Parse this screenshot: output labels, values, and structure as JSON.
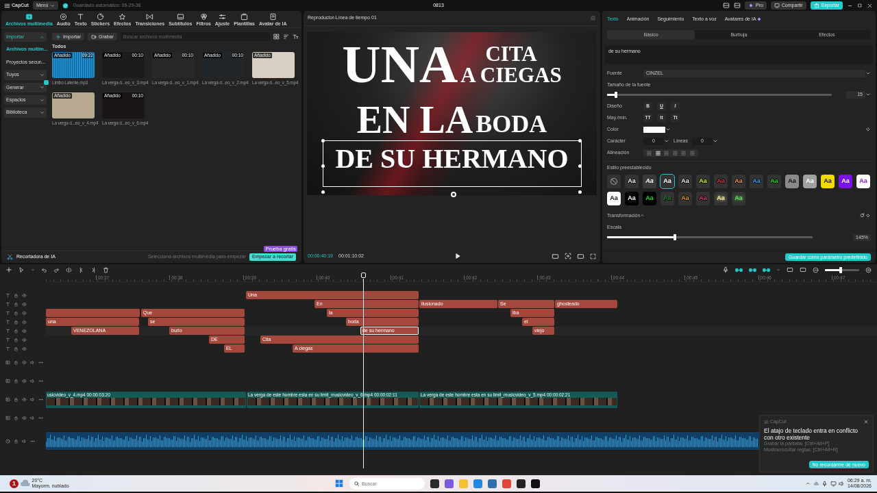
{
  "titlebar": {
    "app": "CapCut",
    "menu": "Menú",
    "autosave": "Guardado automático: 06-29-36",
    "project": "0813",
    "pro": "Pro",
    "share": "Compartir",
    "export": "Exportar"
  },
  "media_panel": {
    "tabs": [
      {
        "label": "Archivos multimedia",
        "selected": true
      },
      {
        "label": "Audio",
        "selected": false
      },
      {
        "label": "Texto",
        "selected": false
      },
      {
        "label": "Stickers",
        "selected": false
      },
      {
        "label": "Efectos",
        "selected": false
      },
      {
        "label": "Transiciones",
        "selected": false
      },
      {
        "label": "Subtítulos",
        "selected": false
      },
      {
        "label": "Filtros",
        "selected": false
      },
      {
        "label": "Ajuste",
        "selected": false
      },
      {
        "label": "Plantillas",
        "selected": false
      },
      {
        "label": "Avatar de IA",
        "selected": false
      }
    ],
    "sidebar": [
      {
        "label": "Importar",
        "kind": "group",
        "expanded": true,
        "selected": false,
        "has_badge": false
      },
      {
        "label": "Archivos multim...",
        "kind": "item",
        "selected": true
      },
      {
        "label": "Proyectos secun...",
        "kind": "item",
        "selected": false
      },
      {
        "label": "Tuyos",
        "kind": "group",
        "expanded": false,
        "selected": false,
        "has_badge": false
      },
      {
        "label": "Generar",
        "kind": "group",
        "expanded": false,
        "selected": false,
        "has_badge": true
      },
      {
        "label": "Espacios",
        "kind": "group",
        "expanded": false,
        "selected": false,
        "has_badge": false
      },
      {
        "label": "Biblioteca",
        "kind": "group",
        "expanded": false,
        "selected": false,
        "has_badge": false
      }
    ],
    "import_button": "Importar",
    "record_button": "Grabar",
    "search": {
      "placeholder": "Buscar archivos multimedia"
    },
    "filter": "Todos",
    "items": [
      {
        "name": "Limbo Latente.mp3",
        "badge": "Añadido",
        "duration": "09:22",
        "kind": "audio"
      },
      {
        "name": "La verga d...eo_v_3.mp4",
        "badge": "Añadido",
        "duration": "00:10",
        "kind": "video"
      },
      {
        "name": "La verga d...eo_v_1.mp4",
        "badge": "Añadido",
        "duration": "00:10",
        "kind": "video"
      },
      {
        "name": "La verga d...eo_v_2.mp4",
        "badge": "Añadido",
        "duration": "00:10",
        "kind": "video"
      },
      {
        "name": "La verga d...eo_v_5.mp4",
        "badge": "Añadido",
        "kind": "video"
      },
      {
        "name": "La verga d...eo_v_4.mp4",
        "badge": "Añadido",
        "kind": "video"
      },
      {
        "name": "La verga d...eo_v_6.mp4",
        "badge": "Añadido",
        "duration": "00:10",
        "kind": "video"
      }
    ],
    "trimmer": {
      "title": "Recortadora de IA",
      "hint": "Selecciona archivos multimedia para empezar",
      "button": "Empezar a recortar",
      "tag": "Prueba gratis"
    }
  },
  "player": {
    "title": "Reproductor-Línea de tiempo 01",
    "big": "UNA",
    "small_lines": [
      "CITA",
      "A CIEGAS"
    ],
    "line_a": "EN LA",
    "line_b": "BODA",
    "selected_line": "DE SU HERMANO",
    "current_time": "00:00:40:19",
    "duration": "00:01:10:02"
  },
  "inspector": {
    "tabs": [
      {
        "label": "Texto",
        "selected": true
      },
      {
        "label": "Animación",
        "selected": false
      },
      {
        "label": "Seguimiento",
        "selected": false
      },
      {
        "label": "Texto a voz",
        "selected": false
      },
      {
        "label": "Avatares de IA",
        "selected": false
      }
    ],
    "subtabs": [
      {
        "label": "Básico",
        "selected": true
      },
      {
        "label": "Burbuja",
        "selected": false
      },
      {
        "label": "Efectos",
        "selected": false
      }
    ],
    "text": "de su hermano",
    "font_label": "Fuente",
    "font": "CINZEL",
    "size_label": "Tamaño de la fuente",
    "size": {
      "level": 0.04
    },
    "size_value": "15",
    "design_label": "Diseño",
    "design": [
      "B",
      "U",
      "I"
    ],
    "case_label": "May./min.",
    "cases": [
      "TT",
      "tt",
      "Tt"
    ],
    "color_label": "Color",
    "color": "#ffffff",
    "char_label": "Carácter",
    "char_value": "0",
    "lines_label": "Líneas",
    "lines_value": "0",
    "align_label": "Alineación",
    "alignments": [
      {
        "selected": false
      },
      {
        "selected": true
      },
      {
        "selected": false
      },
      {
        "selected": false
      },
      {
        "selected": false
      },
      {
        "selected": false
      }
    ],
    "presets_label": "Estilo preestablecido",
    "presets": [
      {
        "kind": "none",
        "selected": false
      },
      {
        "kind": "outline",
        "label": "Aa",
        "color": "#ffffff",
        "selected": false
      },
      {
        "kind": "hollow",
        "label": "Aa",
        "color": "#ffffff",
        "selected": false
      },
      {
        "kind": "plain",
        "label": "Aa",
        "color": "#ffffff",
        "selected": true
      },
      {
        "kind": "outline",
        "label": "Aa",
        "color": "#f8f8f8",
        "selected": false
      },
      {
        "kind": "outline",
        "label": "Aa",
        "color": "#e4f02a",
        "selected": false
      },
      {
        "kind": "outline",
        "label": "Aa",
        "color": "#e23a4a",
        "selected": false
      },
      {
        "kind": "outline",
        "label": "Aa",
        "color": "#f0a050",
        "selected": false
      },
      {
        "kind": "outline",
        "label": "Aa",
        "color": "#4aa8f0",
        "selected": false
      },
      {
        "kind": "outline",
        "label": "Aa",
        "color": "#20e020",
        "selected": false
      },
      {
        "kind": "filled",
        "label": "Aa",
        "color": "#8a8a8a",
        "selected": false
      },
      {
        "kind": "filled",
        "label": "Aa",
        "color": "#a0a0a0",
        "selected": false
      },
      {
        "kind": "filled",
        "label": "Aa",
        "color": "#f2dc00",
        "selected": false
      },
      {
        "kind": "filled",
        "label": "Aa",
        "color": "#7a12e8",
        "selected": false
      },
      {
        "kind": "filled",
        "label": "Aa",
        "color": "#ffffff",
        "selected": false
      },
      {
        "kind": "filled",
        "label": "Aa",
        "color": "#fefefe",
        "selected": false
      },
      {
        "kind": "filled",
        "label": "Aa",
        "color": "#000000",
        "selected": false
      },
      {
        "kind": "filled",
        "label": "Aa",
        "color": "#010101",
        "selected": false
      },
      {
        "kind": "shadow",
        "label": "Aa",
        "color": "#1a7a1a",
        "selected": false
      },
      {
        "kind": "outline",
        "label": "Aa",
        "color": "#f0a020",
        "selected": false
      },
      {
        "kind": "outline",
        "label": "Aa",
        "color": "#e84070",
        "selected": false
      },
      {
        "kind": "glow",
        "label": "Aa",
        "color": "#f5f0a0",
        "selected": false
      },
      {
        "kind": "glow",
        "label": "Aa",
        "color": "#60e060",
        "selected": false
      }
    ],
    "transform_label": "Transformación",
    "scale_label": "Escala",
    "scale": {
      "level": 0.33
    },
    "scale_value": "145%",
    "save_button": "Guardar como parámetro predefinido"
  },
  "timeline": {
    "zoom": {
      "level": 0.45
    },
    "ticks": [
      "00:37",
      "00:38",
      "00:39",
      "00:40",
      "00:41",
      "00:42",
      "00:43",
      "00:44",
      "00:45",
      "00:46",
      "00:47"
    ],
    "tracks": [
      {
        "kind": "text",
        "clips": [
          {
            "label": "Una",
            "selected": false
          }
        ]
      },
      {
        "kind": "text",
        "clips": [
          {
            "label": "En",
            "selected": false
          },
          {
            "label": "ilusionado",
            "selected": false
          },
          {
            "label": "Se",
            "selected": false
          },
          {
            "label": "ghosteado",
            "selected": false
          }
        ]
      },
      {
        "kind": "text",
        "clips": [
          {
            "selected": false
          },
          {
            "label": "Que",
            "selected": false
          },
          {
            "label": "la",
            "selected": false
          },
          {
            "label": "iba",
            "selected": false
          }
        ]
      },
      {
        "kind": "text",
        "clips": [
          {
            "label": "una",
            "selected": false
          },
          {
            "label": "se",
            "selected": false
          },
          {
            "label": "boda",
            "selected": false
          },
          {
            "label": "el",
            "selected": false
          }
        ]
      },
      {
        "kind": "text",
        "clips": [
          {
            "label": "VENEZOLANA",
            "selected": false
          },
          {
            "label": "burlo",
            "selected": false
          },
          {
            "label": "de su hermano",
            "selected": true
          },
          {
            "label": "viejo",
            "selected": false
          }
        ]
      },
      {
        "kind": "text",
        "clips": [
          {
            "label": "DE",
            "selected": false
          },
          {
            "label": "Cita",
            "selected": false
          }
        ]
      },
      {
        "kind": "text",
        "clips": [
          {
            "label": "EL",
            "selected": false
          },
          {
            "label": "A ciegas",
            "selected": false
          }
        ]
      },
      {
        "kind": "video"
      },
      {
        "kind": "video"
      },
      {
        "kind": "video",
        "clips": [
          {
            "label": "usicvideo_v_4.mp4",
            "duration": "00:00:03:20",
            "selected": false
          },
          {
            "label": "La verga de este hombre esta en su limit_musicvideo_v_6.mp4",
            "duration": "00:00:02:11",
            "selected": false
          },
          {
            "label": "La verga de este hombre esta en su limit_musicvideo_v_5.mp4",
            "duration": "00:00:02:21",
            "selected": false
          }
        ]
      },
      {
        "kind": "video"
      },
      {
        "kind": "audio",
        "clips": [
          {
            "selected": false
          }
        ]
      }
    ]
  },
  "toast": {
    "app": "CapCut",
    "title": "El atajo de teclado entra en conflicto con otro existente",
    "lines": [
      "Grabar la pantalla: [Ctrl+Alt+P]",
      "Mostrar/ocultar reglas: [Ctrl+Alt+R]"
    ],
    "button": "No recordarme de nuevo"
  },
  "taskbar": {
    "notifications": "1",
    "temperature": "20°C",
    "weather": "Mayorm. nublado",
    "search": {
      "placeholder": "Buscar"
    },
    "time": "06:29 a. m.",
    "date": "14/08/2026"
  }
}
